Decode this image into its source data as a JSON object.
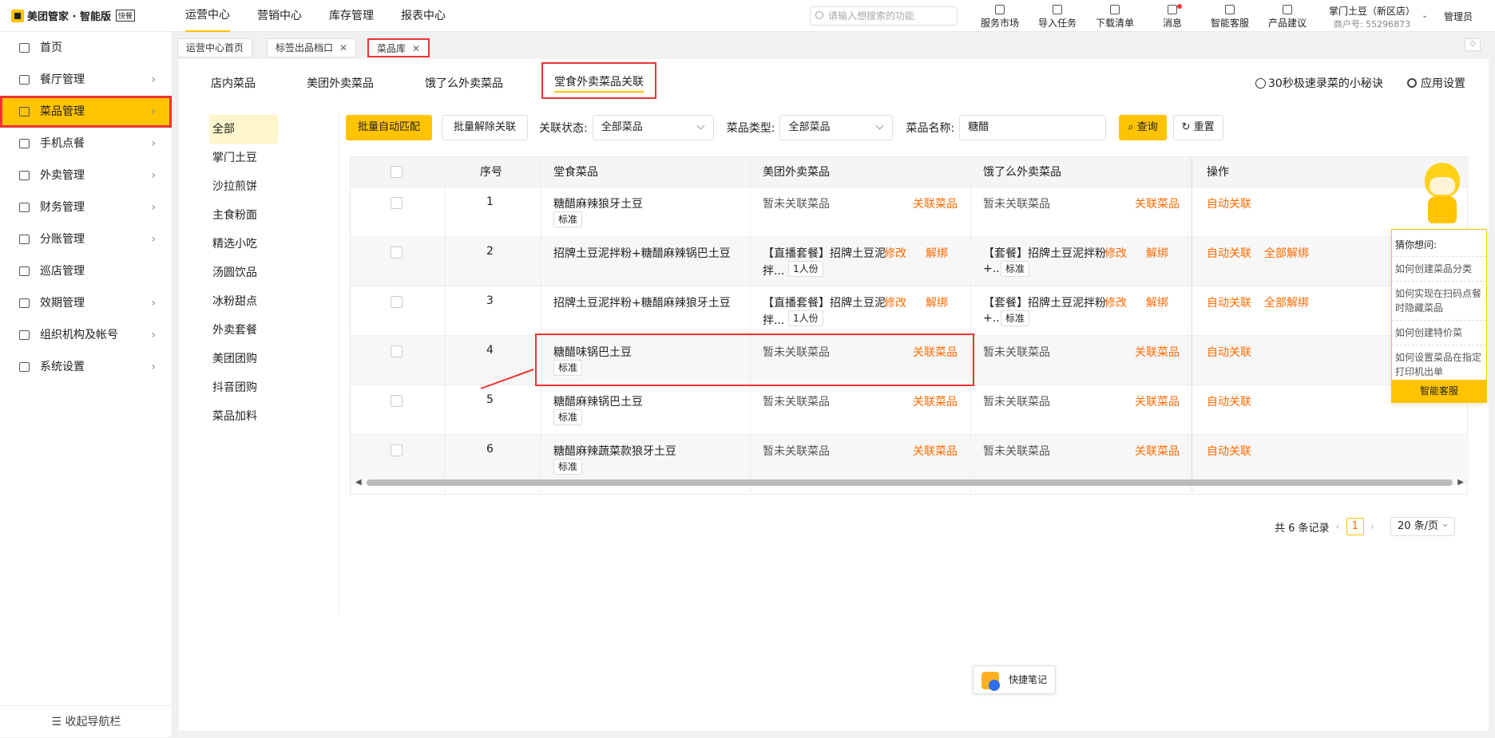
{
  "app": {
    "logo": "美团管家 · 智能版",
    "logo_badge": "快餐"
  },
  "topnav": [
    "运营中心",
    "营销中心",
    "库存管理",
    "报表中心"
  ],
  "search": {
    "placeholder": "请输入想搜索的功能"
  },
  "tools": [
    "服务市场",
    "导入任务",
    "下载清单",
    "消息",
    "智能客服",
    "产品建议"
  ],
  "store": {
    "name": "掌门土豆（新区店）",
    "merchant": "商户号: 55296873"
  },
  "admin": "管理员",
  "sidebar": {
    "items": [
      "首页",
      "餐厅管理",
      "菜品管理",
      "手机点餐",
      "外卖管理",
      "财务管理",
      "分账管理",
      "巡店管理",
      "效期管理",
      "组织机构及帐号",
      "系统设置"
    ],
    "collapse": "收起导航栏"
  },
  "pagetabs": [
    "运营中心首页",
    "标签出品档口",
    "菜品库"
  ],
  "subtabs": [
    "店内菜品",
    "美团外卖菜品",
    "饿了么外卖菜品",
    "堂食外卖菜品关联"
  ],
  "tips": "30秒极速录菜的小秘诀",
  "appsettings": "应用设置",
  "categories": [
    "全部",
    "掌门土豆",
    "沙拉煎饼",
    "主食粉面",
    "精选小吃",
    "汤圆饮品",
    "冰粉甜点",
    "外卖套餐",
    "美团团购",
    "抖音团购",
    "菜品加料"
  ],
  "filters": {
    "batch_match": "批量自动匹配",
    "batch_unlink": "批量解除关联",
    "status_label": "关联状态:",
    "status_value": "全部菜品",
    "type_label": "菜品类型:",
    "type_value": "全部菜品",
    "name_label": "菜品名称:",
    "name_value": "糖醋",
    "query": "查询",
    "reset": "重置"
  },
  "table": {
    "headers": [
      "序号",
      "堂食菜品",
      "美团外卖菜品",
      "饿了么外卖菜品",
      "操作"
    ],
    "rows": [
      {
        "no": "1",
        "dish": "糖醋麻辣狼牙土豆",
        "tag": "标准",
        "mt": "暂未关联菜品",
        "mt_action": "关联菜品",
        "elm": "暂未关联菜品",
        "elm_action": "关联菜品",
        "ops": [
          "自动关联"
        ]
      },
      {
        "no": "2",
        "dish": "招牌土豆泥拌粉+糖醋麻辣锅巴土豆",
        "mt": "【直播套餐】招牌土豆泥",
        "mt_more": "拌...",
        "mt_tag": "1人份",
        "mt_edit": "修改",
        "mt_unbind": "解绑",
        "elm": "【套餐】招牌土豆泥拌粉",
        "elm_more": "+...",
        "elm_tag": "标准",
        "elm_edit": "修改",
        "elm_unbind": "解绑",
        "ops": [
          "自动关联",
          "全部解绑"
        ]
      },
      {
        "no": "3",
        "dish": "招牌土豆泥拌粉+糖醋麻辣狼牙土豆",
        "mt": "【直播套餐】招牌土豆泥",
        "mt_more": "拌...",
        "mt_tag": "1人份",
        "mt_edit": "修改",
        "mt_unbind": "解绑",
        "elm": "【套餐】招牌土豆泥拌粉",
        "elm_more": "+...",
        "elm_tag": "标准",
        "elm_edit": "修改",
        "elm_unbind": "解绑",
        "ops": [
          "自动关联",
          "全部解绑"
        ]
      },
      {
        "no": "4",
        "dish": "糖醋味锅巴土豆",
        "tag": "标准",
        "mt": "暂未关联菜品",
        "mt_action": "关联菜品",
        "elm": "暂未关联菜品",
        "elm_action": "关联菜品",
        "ops": [
          "自动关联"
        ]
      },
      {
        "no": "5",
        "dish": "糖醋麻辣锅巴土豆",
        "tag": "标准",
        "mt": "暂未关联菜品",
        "mt_action": "关联菜品",
        "elm": "暂未关联菜品",
        "elm_action": "关联菜品",
        "ops": [
          "自动关联"
        ]
      },
      {
        "no": "6",
        "dish": "糖醋麻辣蔬菜款狼牙土豆",
        "tag": "标准",
        "mt": "暂未关联菜品",
        "mt_action": "关联菜品",
        "elm": "暂未关联菜品",
        "elm_action": "关联菜品",
        "ops": [
          "自动关联"
        ]
      }
    ]
  },
  "pager": {
    "total": "共 6 条记录",
    "page": "1",
    "size": "20 条/页"
  },
  "help": {
    "title": "猜你想问:",
    "items": [
      "如何创建菜品分类",
      "如何实现在扫码点餐时隐藏菜品",
      "如何创建特价菜",
      "如何设置菜品在指定打印机出单"
    ],
    "button": "智能客服"
  },
  "note": "快捷笔记",
  "colors": {
    "accent": "#ffc300",
    "link": "#ff6a00",
    "highlight": "#e33333"
  }
}
